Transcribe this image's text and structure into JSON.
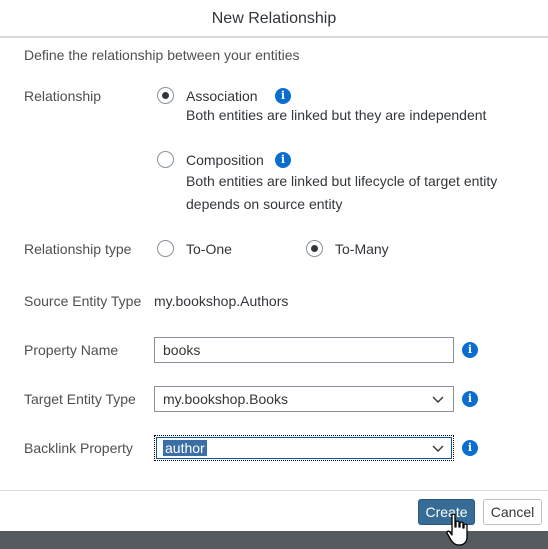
{
  "dialog": {
    "title": "New Relationship",
    "description": "Define the relationship between your entities"
  },
  "relationship": {
    "label": "Relationship",
    "options": [
      {
        "label": "Association",
        "description_lines": [
          "Both entities are linked but they are independent"
        ],
        "selected": true
      },
      {
        "label": "Composition",
        "description_lines": [
          "Both entities are linked but lifecycle of target entity",
          "depends on source entity"
        ],
        "selected": false
      }
    ]
  },
  "relationship_type": {
    "label": "Relationship type",
    "options": [
      {
        "label": "To-One",
        "selected": false
      },
      {
        "label": "To-Many",
        "selected": true
      }
    ]
  },
  "source_entity": {
    "label": "Source Entity Type",
    "value": "my.bookshop.Authors"
  },
  "property_name": {
    "label": "Property Name",
    "value": "books"
  },
  "target_entity": {
    "label": "Target Entity Type",
    "value": "my.bookshop.Books"
  },
  "backlink": {
    "label": "Backlink Property",
    "value": "author"
  },
  "footer": {
    "create_label": "Create",
    "cancel_label": "Cancel"
  },
  "icons": {
    "info": "info-icon",
    "dropdown": "chevron-down-icon",
    "cursor": "hand-pointer-icon"
  },
  "colors": {
    "info_blue": "#0a6ed1",
    "primary_button": "#376c97",
    "selection_highlight": "#3a6ea5"
  }
}
